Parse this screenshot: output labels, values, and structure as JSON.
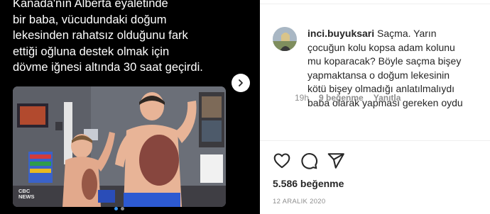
{
  "post": {
    "caption_lines": [
      "Kanada'nın Alberta eyaletinde",
      "bir baba, vücudundaki doğum",
      "lekesinden rahatsız olduğunu fark",
      "ettiği oğluna destek olmak için",
      "dövme iğnesi altında 30 saat geçirdi."
    ],
    "photo_watermark_line1": "CBC",
    "photo_watermark_line2": "NEWS",
    "next_icon": "chevron-right-icon",
    "carousel_dots": 2,
    "carousel_active_index": 0
  },
  "comment": {
    "username": "inci.buyuksari",
    "lines": [
      "Saçma. Yarın",
      "çocuğun kolu kopsa adam kolunu",
      "mu koparacak? Böyle saçma bişey",
      "yapmaktansa o doğum lekesinin",
      "kötü bişey olmadığı anlatılmalıydı",
      "baba olarak yapması gereken oydu"
    ],
    "time": "19h",
    "likes": "9 beğenme",
    "reply": "Yanıtla"
  },
  "actions": {
    "like_icon": "heart-icon",
    "comment_icon": "comment-icon",
    "share_icon": "share-icon"
  },
  "likes_count": "5.586 beğenme",
  "date": "12 ARALIK 2020",
  "colors": {
    "accent": "#3897f0",
    "text": "#262626",
    "muted": "#8e8e8e"
  }
}
